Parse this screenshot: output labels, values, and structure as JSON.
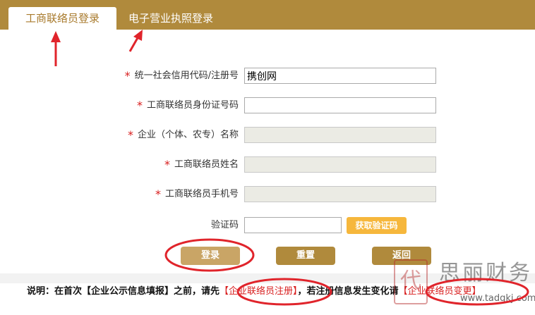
{
  "tabs": [
    {
      "label": "工商联络员登录",
      "active": true
    },
    {
      "label": "电子营业执照登录",
      "active": false
    }
  ],
  "form": {
    "fields": [
      {
        "label": "统一社会信用代码/注册号",
        "required": true,
        "value": "携创网",
        "disabled": false
      },
      {
        "label": "工商联络员身份证号码",
        "required": true,
        "value": "",
        "disabled": false
      },
      {
        "label": "企业（个体、农专）名称",
        "required": true,
        "value": "",
        "disabled": true
      },
      {
        "label": "工商联络员姓名",
        "required": true,
        "value": "",
        "disabled": true
      },
      {
        "label": "工商联络员手机号",
        "required": true,
        "value": "",
        "disabled": true
      }
    ],
    "required_mark": "*",
    "captcha": {
      "label": "验证码",
      "value": "",
      "button_label": "获取验证码"
    }
  },
  "buttons": {
    "login": "登录",
    "reset": "重置",
    "back": "返回"
  },
  "note": {
    "prefix": "说明：在首次【企业公示信息填报】之前，请先",
    "register_link": "【企业联络员注册】",
    "middle": "，若注册信息发生变化请",
    "change_link": "【企业联络员变更】"
  },
  "watermark": {
    "seal_char": "代",
    "title": "思丽财务",
    "url": "www.tadgkj.com"
  },
  "colors": {
    "brand": "#b08a3c",
    "accent_tab_text": "#a87a2c",
    "required_star": "#d81e1e",
    "code_button": "#f6b73c",
    "annotation_red": "#e0242b"
  }
}
